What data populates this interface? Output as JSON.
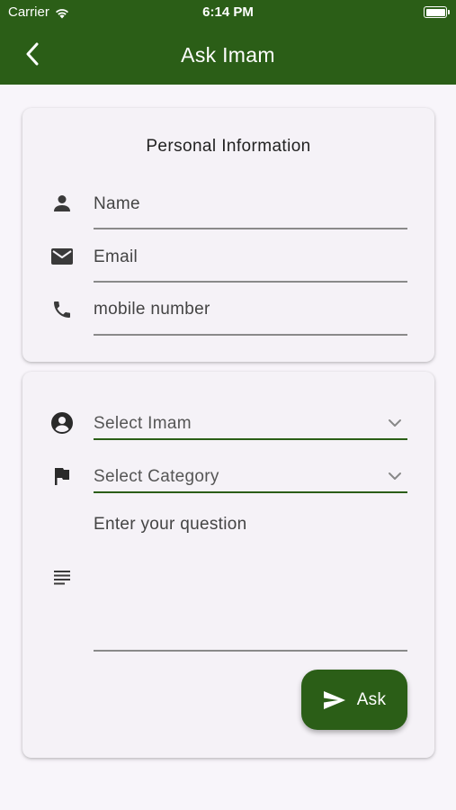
{
  "status_bar": {
    "carrier": "Carrier",
    "time": "6:14 PM"
  },
  "app_bar": {
    "title": "Ask Imam",
    "background_color": "#2b5e17"
  },
  "personal_info": {
    "title": "Personal Information",
    "name_placeholder": "Name",
    "email_placeholder": "Email",
    "mobile_placeholder": "mobile number"
  },
  "question_form": {
    "imam_select": "Select Imam",
    "category_select": "Select Category",
    "question_placeholder": "Enter your question",
    "ask_label": "Ask"
  },
  "icons": {
    "back": "back-arrow-icon",
    "name": "person-icon",
    "email": "mail-icon",
    "mobile": "phone-icon",
    "imam": "account-circle-icon",
    "category": "flag-icon",
    "question": "notes-icon",
    "send": "send-icon",
    "dropdown": "chevron-down-icon"
  },
  "colors": {
    "accent": "#2b5e17",
    "background": "#f8f5fa",
    "card": "#f5f2f7"
  }
}
